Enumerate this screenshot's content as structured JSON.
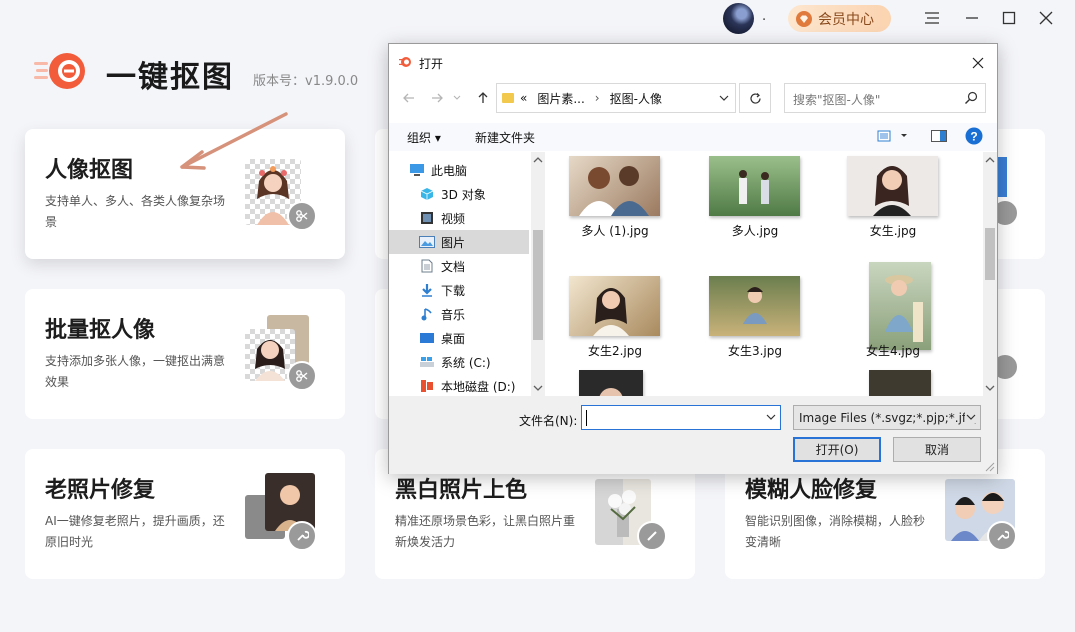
{
  "topbar": {
    "user_name": ".",
    "vip_label": "会员中心"
  },
  "app": {
    "title": "一键抠图",
    "version": "版本号：v1.9.0.0"
  },
  "cards": [
    {
      "title": "人像抠图",
      "desc": "支持单人、多人、各类人像复杂场景"
    },
    {
      "title": "批量抠人像",
      "desc": "支持添加多张人像，一键抠出满意效果"
    },
    {
      "title": "老照片修复",
      "desc": "AI一键修复老照片，提升画质，还原旧时光"
    },
    {
      "title": "黑白照片上色",
      "desc": "精准还原场景色彩，让黑白照片重新焕发活力"
    },
    {
      "title": "模糊人脸修复",
      "desc": "智能识别图像，消除模糊，人脸秒变清晰"
    }
  ],
  "dialog": {
    "title": "打开",
    "address": {
      "prefix": "«",
      "seg1": "图片素...",
      "sep": "›",
      "seg2": "抠图-人像"
    },
    "search_placeholder": "搜索\"抠图-人像\"",
    "toolbar": {
      "organize": "组织 ▾",
      "new_folder": "新建文件夹"
    },
    "tree": [
      {
        "label": "此电脑",
        "icon": "computer-icon"
      },
      {
        "label": "3D 对象",
        "icon": "cube-icon"
      },
      {
        "label": "视频",
        "icon": "video-icon"
      },
      {
        "label": "图片",
        "icon": "picture-icon"
      },
      {
        "label": "文档",
        "icon": "document-icon"
      },
      {
        "label": "下载",
        "icon": "download-icon"
      },
      {
        "label": "音乐",
        "icon": "music-icon"
      },
      {
        "label": "桌面",
        "icon": "desktop-icon"
      },
      {
        "label": "系统 (C:)",
        "icon": "drive-icon"
      },
      {
        "label": "本地磁盘 (D:)",
        "icon": "drive-icon"
      }
    ],
    "files": [
      {
        "name": "多人 (1).jpg"
      },
      {
        "name": "多人.jpg"
      },
      {
        "name": "女生.jpg"
      },
      {
        "name": "女生2.jpg"
      },
      {
        "name": "女生3.jpg"
      },
      {
        "name": "女生4.jpg"
      }
    ],
    "filename_label": "文件名(N):",
    "filename_value": "",
    "filetype": "Image Files (*.svgz;*.pjp;*.jfif;",
    "open_button": "打开(O)",
    "cancel_button": "取消"
  },
  "colors": {
    "accent_orange": "#f25c3b",
    "dialog_blue": "#2a73d6",
    "arrow": "#d6927a"
  }
}
